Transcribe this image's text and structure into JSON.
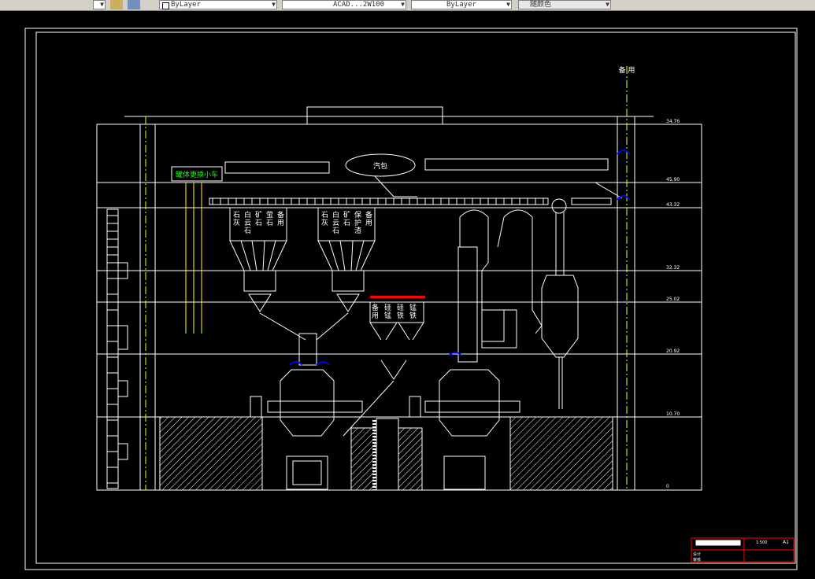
{
  "toolbar": {
    "layer_color": "ByLayer",
    "linetype": "ACAD...2W100",
    "lineweight": "ByLayer",
    "plot_style": "随颜色"
  },
  "drawing": {
    "spare_top": "备\n用",
    "drum_label": "汽包",
    "cart_label": "罐体更换小车",
    "elevations": [
      "34.76",
      "45.90",
      "43.32",
      "32.32",
      "25.02",
      "20.92",
      "10.70",
      "0"
    ],
    "bins_left": [
      "石灰",
      "白云石",
      "矿石",
      "萤石",
      "备用"
    ],
    "bins_right": [
      "石灰",
      "白云石",
      "矿石",
      "保护渣",
      "备用"
    ],
    "alloy_bins": [
      "备用",
      "硅锰",
      "硅铁",
      "锰铁"
    ],
    "title_block": {
      "scale": "1:500",
      "size": "A1",
      "label_a": "设计",
      "label_b": "审核"
    }
  },
  "colors": {
    "line": "#ffffff",
    "yellow": "#ffff00",
    "blue": "#0000ff",
    "red": "#ff0000",
    "green": "#00ff00"
  }
}
